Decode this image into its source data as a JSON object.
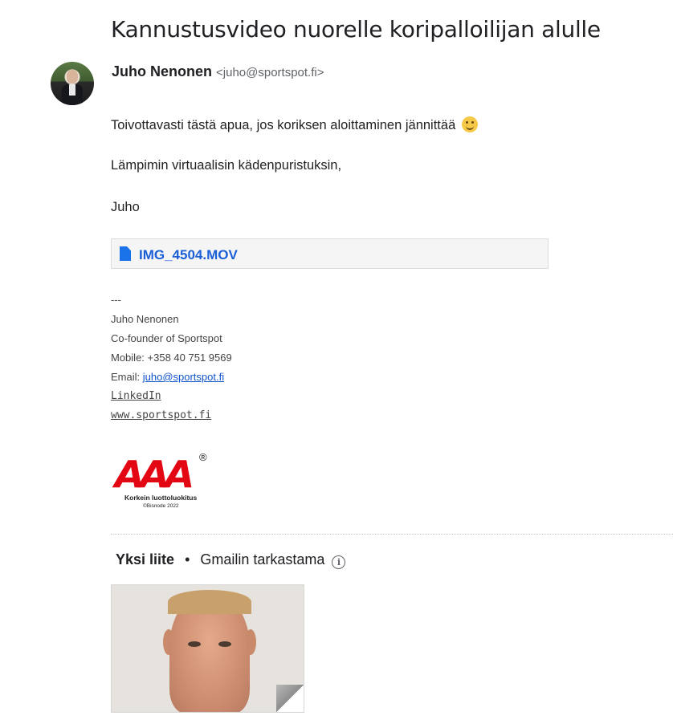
{
  "email": {
    "subject": "Kannustusvideo nuorelle koripalloilijan alulle",
    "sender_name": "Juho Nenonen",
    "sender_email": "<juho@sportspot.fi>",
    "body": {
      "line1": "Toivottavasti tästä apua, jos koriksen aloittaminen jännittää",
      "line2": "Lämpimin virtuaalisin kädenpuristuksin,",
      "line3": "Juho"
    },
    "inline_attachment": "IMG_4504.MOV"
  },
  "signature": {
    "separator": "---",
    "name": "Juho Nenonen",
    "title": "Co-founder of Sportspot",
    "mobile": "Mobile: +358 40 751 9569",
    "email_label": "Email: ",
    "email_link": "juho@sportspot.fi",
    "linkedin": "LinkedIn",
    "website": "www.sportspot.fi"
  },
  "logo": {
    "text": "AAA",
    "registered": "®",
    "tagline": "Korkein luottoluokitus",
    "source": "©Bisnode 2022",
    "color": "#e30613"
  },
  "attachments": {
    "count_label": "Yksi liite",
    "separator": "•",
    "scan_label": "Gmailin tarkastama",
    "info_icon": "info-icon"
  },
  "colors": {
    "link": "#1155cc",
    "attachment_name": "#1a5fd6",
    "file_icon": "#1a73e8"
  }
}
